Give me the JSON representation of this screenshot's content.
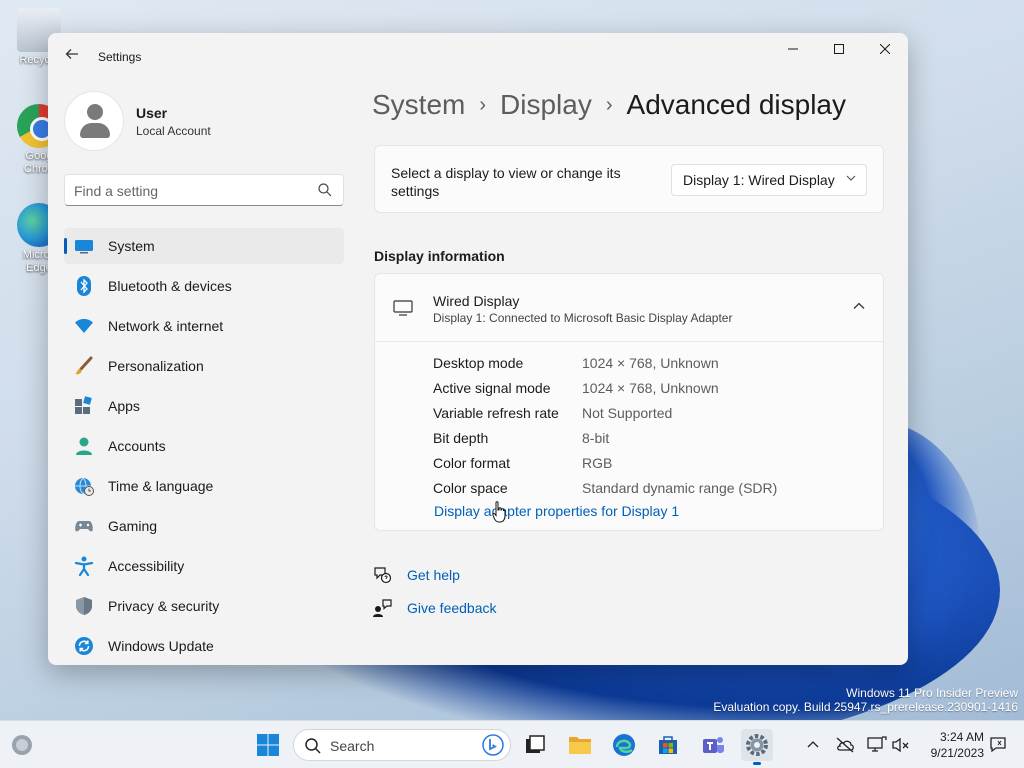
{
  "desktop": {
    "icons": [
      {
        "label": "Recycle"
      },
      {
        "label": "Goog\nChron"
      },
      {
        "label": "Micros\nEdge"
      }
    ],
    "watermark": {
      "line1": "Windows 11 Pro Insider Preview",
      "line2": "Evaluation copy. Build 25947.rs_prerelease.230901-1416"
    }
  },
  "window": {
    "title": "Settings",
    "user": {
      "name": "User",
      "account_type": "Local Account"
    },
    "search": {
      "placeholder": "Find a setting"
    },
    "nav": [
      {
        "label": "System",
        "icon": "monitor-icon",
        "selected": true
      },
      {
        "label": "Bluetooth & devices",
        "icon": "bluetooth-icon"
      },
      {
        "label": "Network & internet",
        "icon": "wifi-icon"
      },
      {
        "label": "Personalization",
        "icon": "brush-icon"
      },
      {
        "label": "Apps",
        "icon": "apps-icon"
      },
      {
        "label": "Accounts",
        "icon": "person-icon"
      },
      {
        "label": "Time & language",
        "icon": "globe-clock-icon"
      },
      {
        "label": "Gaming",
        "icon": "gamepad-icon"
      },
      {
        "label": "Accessibility",
        "icon": "accessibility-icon"
      },
      {
        "label": "Privacy & security",
        "icon": "shield-icon"
      },
      {
        "label": "Windows Update",
        "icon": "update-icon"
      }
    ],
    "breadcrumb": {
      "level1": "System",
      "level2": "Display",
      "current": "Advanced display",
      "separator": "›"
    },
    "select_display": {
      "prompt": "Select a display to view or change its settings",
      "selected": "Display 1: Wired Display"
    },
    "display_info": {
      "section_title": "Display information",
      "name": "Wired Display",
      "description": "Display 1: Connected to Microsoft Basic Display Adapter",
      "rows": [
        {
          "key": "Desktop mode",
          "value": "1024 × 768, Unknown"
        },
        {
          "key": "Active signal mode",
          "value": "1024 × 768, Unknown"
        },
        {
          "key": "Variable refresh rate",
          "value": "Not Supported"
        },
        {
          "key": "Bit depth",
          "value": "8-bit"
        },
        {
          "key": "Color format",
          "value": "RGB"
        },
        {
          "key": "Color space",
          "value": "Standard dynamic range (SDR)"
        }
      ],
      "adapter_link": "Display adapter properties for Display 1"
    },
    "help": {
      "get_help": "Get help",
      "give_feedback": "Give feedback"
    }
  },
  "taskbar": {
    "search_placeholder": "Search",
    "clock": {
      "time": "3:24 AM",
      "date": "9/21/2023"
    }
  },
  "colors": {
    "accent": "#005fb8",
    "window_bg": "#f3f3f3",
    "card_bg": "#fbfbfb"
  }
}
